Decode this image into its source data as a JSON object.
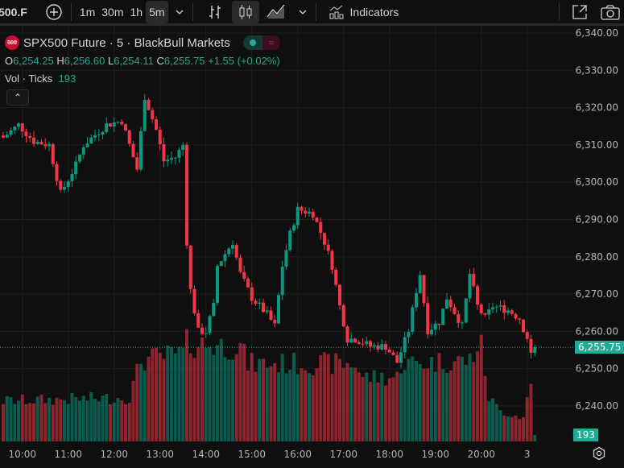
{
  "toolbar": {
    "symbol": "500.F",
    "intervals": [
      "1m",
      "30m",
      "1h",
      "5m"
    ],
    "active_interval": "5m",
    "indicators_label": "Indicators"
  },
  "legend": {
    "logo_text": "500",
    "title": "SPX500 Future · 5 · BlackBull Markets",
    "o_label": "O",
    "o": "6,254.25",
    "h_label": "H",
    "h": "6,256.60",
    "l_label": "L",
    "l": "6,254.11",
    "c_label": "C",
    "c": "6,255.75",
    "change": "+1.55 (+0.02%)",
    "vol_label": "Vol · Ticks",
    "vol": "193"
  },
  "colors": {
    "up": "#089981",
    "down": "#f23645",
    "accent": "#22ab94",
    "bg": "#0f0f0f",
    "grid": "#1e1e1e"
  },
  "chart_data": {
    "type": "candlestick",
    "symbol": "SPX500 Future",
    "interval": "5m",
    "y_ticks": [
      "6,340.00",
      "6,330.00",
      "6,320.00",
      "6,310.00",
      "6,300.00",
      "6,290.00",
      "6,280.00",
      "6,270.00",
      "6,260.00",
      "6,250.00",
      "6,240.00"
    ],
    "y_tick_values": [
      6340,
      6330,
      6320,
      6310,
      6300,
      6290,
      6280,
      6270,
      6260,
      6250,
      6240
    ],
    "ylim": [
      6235.5,
      6346.5
    ],
    "x_ticks": [
      "10:00",
      "11:00",
      "12:00",
      "13:00",
      "14:00",
      "15:00",
      "16:00",
      "17:00",
      "18:00",
      "19:00",
      "20:00",
      "3"
    ],
    "x_tick_bars": [
      5,
      17,
      29,
      41,
      53,
      65,
      77,
      89,
      101,
      113,
      125,
      137
    ],
    "bar_count": 140,
    "close_keypoints": [
      [
        0,
        6312
      ],
      [
        4,
        6315.4
      ],
      [
        8,
        6311
      ],
      [
        12,
        6310
      ],
      [
        15,
        6297
      ],
      [
        19,
        6304.6
      ],
      [
        21,
        6310
      ],
      [
        27,
        6315.4
      ],
      [
        31,
        6316.5
      ],
      [
        35,
        6303.5
      ],
      [
        37,
        6323
      ],
      [
        40,
        6314
      ],
      [
        42,
        6305.7
      ],
      [
        45,
        6306.7
      ],
      [
        47,
        6310
      ],
      [
        48,
        6284
      ],
      [
        49,
        6271
      ],
      [
        51,
        6260
      ],
      [
        53,
        6260
      ],
      [
        55,
        6266.8
      ],
      [
        56,
        6277.6
      ],
      [
        60,
        6284
      ],
      [
        62,
        6275.4
      ],
      [
        65,
        6269
      ],
      [
        69,
        6264.6
      ],
      [
        71,
        6261.4
      ],
      [
        73,
        6277.6
      ],
      [
        75,
        6286.2
      ],
      [
        77,
        6292.7
      ],
      [
        81,
        6291.6
      ],
      [
        84,
        6284
      ],
      [
        86,
        6277.6
      ],
      [
        88,
        6266.8
      ],
      [
        90,
        6258
      ],
      [
        92,
        6258
      ],
      [
        96,
        6256
      ],
      [
        100,
        6256
      ],
      [
        103,
        6251.7
      ],
      [
        106,
        6260.3
      ],
      [
        108,
        6271
      ],
      [
        109,
        6275.4
      ],
      [
        111,
        6260.3
      ],
      [
        114,
        6262.5
      ],
      [
        116,
        6269
      ],
      [
        120,
        6261.4
      ],
      [
        122,
        6275.4
      ],
      [
        124,
        6266.8
      ],
      [
        126,
        6263.5
      ],
      [
        128,
        6266.8
      ],
      [
        132,
        6265.7
      ],
      [
        135,
        6263.5
      ],
      [
        137,
        6258
      ],
      [
        138,
        6254.25
      ],
      [
        139,
        6255.75
      ]
    ],
    "volume_keypoints": [
      [
        0,
        1200
      ],
      [
        33,
        1300
      ],
      [
        36,
        2400
      ],
      [
        47,
        2600
      ],
      [
        48,
        2900
      ],
      [
        62,
        2800
      ],
      [
        64,
        2300
      ],
      [
        92,
        2300
      ],
      [
        94,
        1900
      ],
      [
        103,
        1900
      ],
      [
        104,
        2300
      ],
      [
        122,
        2400
      ],
      [
        124,
        2800
      ],
      [
        125,
        2800
      ],
      [
        127,
        1300
      ],
      [
        130,
        900
      ],
      [
        136,
        700
      ],
      [
        137,
        1500
      ],
      [
        138,
        1500
      ],
      [
        139,
        193
      ]
    ],
    "last_price": "6,255.75",
    "last_price_value": 6255.75,
    "last_volume": "193"
  }
}
